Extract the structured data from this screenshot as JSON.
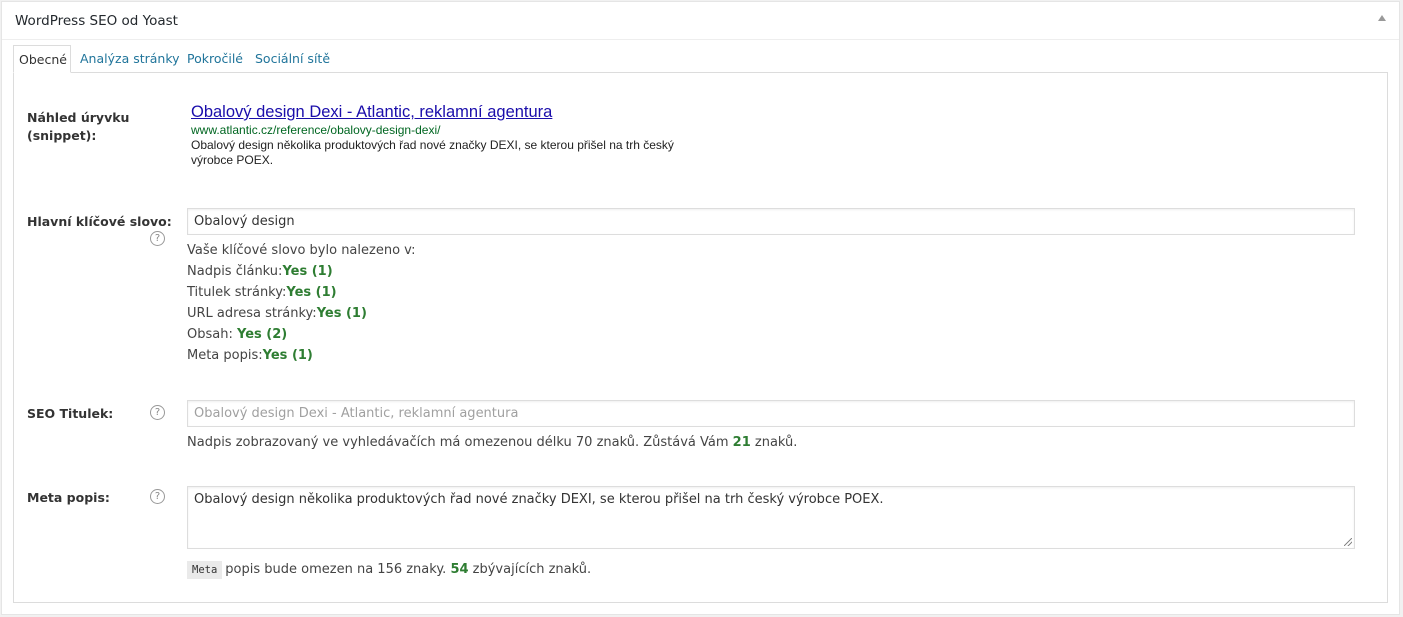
{
  "metabox": {
    "title": "WordPress SEO od Yoast"
  },
  "tabs": [
    {
      "label": "Obecné",
      "active": true
    },
    {
      "label": "Analýza stránky",
      "active": false
    },
    {
      "label": "Pokročilé",
      "active": false
    },
    {
      "label": "Sociální sítě",
      "active": false
    }
  ],
  "snippet": {
    "label": "Náhled úryvku (snippet):",
    "title": "Obalový design Dexi - Atlantic, reklamní agentura",
    "url": "www.atlantic.cz/reference/obalovy-design-dexi/",
    "description": "Obalový design několika produktových řad nové značky DEXI, se kterou přišel na trh český výrobce POEX."
  },
  "focus_keyword": {
    "label": "Hlavní klíčové slovo:",
    "value": "Obalový design",
    "found_intro": "Vaše klíčové slovo bylo nalezeno v:",
    "results": [
      {
        "label": "Nadpis článku:",
        "value": "Yes (1)"
      },
      {
        "label": "Titulek stránky:",
        "value": "Yes (1)"
      },
      {
        "label": "URL adresa stránky:",
        "value": "Yes (1)"
      },
      {
        "label": "Obsah: ",
        "value": "Yes (2)"
      },
      {
        "label": "Meta popis:",
        "value": "Yes (1)"
      }
    ]
  },
  "seo_title": {
    "label": "SEO Titulek:",
    "placeholder": "Obalový design Dexi - Atlantic, reklamní agentura",
    "info_before": "Nadpis zobrazovaný ve vyhledávačích má omezenou délku 70 znaků. Zůstává Vám ",
    "remaining": "21",
    "info_after": " znaků."
  },
  "meta_desc": {
    "label": "Meta popis:",
    "value": "Obalový design několika produktových řad nové značky DEXI, se kterou přišel na trh český výrobce POEX.",
    "code_word": "Meta",
    "info_before": "popis bude omezen na 156 znaky. ",
    "remaining": "54",
    "info_after": " zbývajících znaků."
  },
  "help_icon_glyph": "?",
  "colors": {
    "link": "#21759b",
    "snippet_title": "#1a0dab",
    "snippet_url": "#006621",
    "success": "#2e7d32"
  }
}
